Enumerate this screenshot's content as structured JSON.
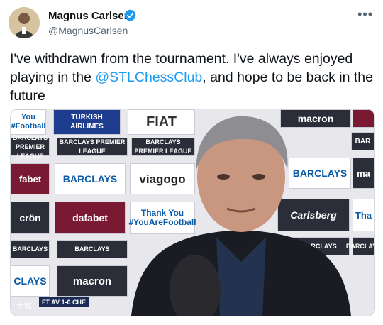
{
  "author": {
    "name": "Magnus Carlsen",
    "handle": "@MagnusCarlsen",
    "verified": true
  },
  "more_icon": "more-horizontal-icon",
  "tweet": {
    "text_before": "I've withdrawn from the tournament. I've always enjoyed playing in the ",
    "mention": "@STLChessClub",
    "text_after": ", and hope to be back in the future"
  },
  "media": {
    "boards": [
      "You #Football",
      "TURKISH AIRLINES",
      "FIAT",
      "Thank",
      "macron",
      "BARCLAYS PREMIER LEAGUE",
      "BARCLAYS PREMIER LEAGUE",
      "BARCLAYS PREMIER LEAGUE",
      "BAR",
      "fabet",
      "BARCLAYS",
      "viagogo",
      "BARCLAYS",
      "ma",
      "crön",
      "dafabet",
      "Thank You #YouAreFootball",
      "Carlsberg",
      "Tha",
      "BARCLAYS",
      "BARCLAYS",
      "BARCLAYS",
      "BARCLAYS",
      "CLAYS",
      "macron"
    ],
    "score": "FT AV 1-0 CHE",
    "watermark": "大都"
  }
}
